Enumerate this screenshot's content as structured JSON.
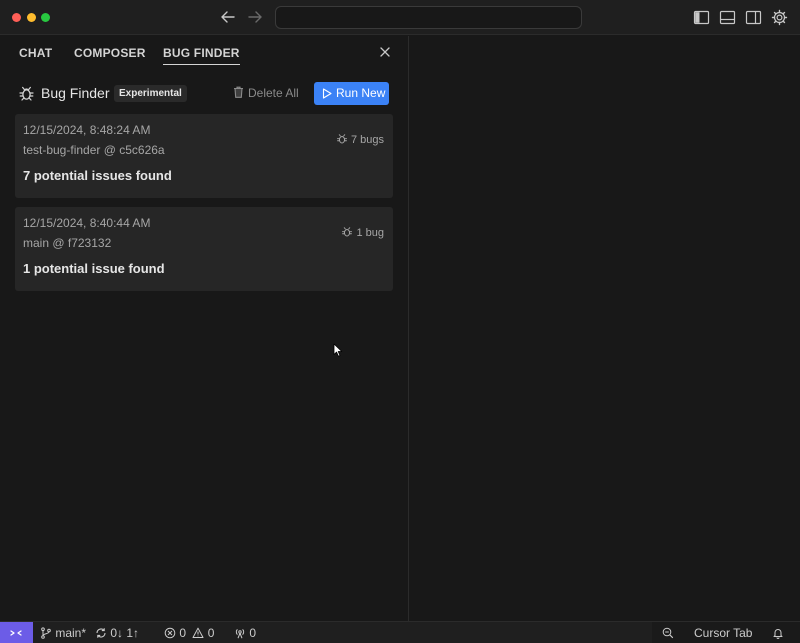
{
  "titlebar": {
    "icons": [
      "back-arrow-icon",
      "forward-arrow-icon",
      "toggle-primary-sidebar-icon",
      "toggle-panel-icon",
      "toggle-secondary-sidebar-icon",
      "gear-icon"
    ]
  },
  "tabs": [
    {
      "label": "CHAT"
    },
    {
      "label": "COMPOSER"
    },
    {
      "label": "BUG FINDER",
      "active": true
    }
  ],
  "bug_finder": {
    "title": "Bug Finder",
    "badge": "Experimental",
    "delete_all_label": "Delete All",
    "run_new_label": "Run New"
  },
  "runs": [
    {
      "timestamp": "12/15/2024, 8:48:24 AM",
      "ref": "test-bug-finder @ c5c626a",
      "bug_count": "7 bugs",
      "summary": "7 potential issues found"
    },
    {
      "timestamp": "12/15/2024, 8:40:44 AM",
      "ref": "main @ f723132",
      "bug_count": "1 bug",
      "summary": "1 potential issue found"
    }
  ],
  "statusbar": {
    "branch": "main*",
    "sync": "0↓ 1↑",
    "errors": "0",
    "warnings": "0",
    "ports": "0",
    "cursor_tab": "Cursor Tab"
  },
  "colors": {
    "accent": "#3b82f6",
    "remote": "#6c5ce7",
    "background": "#181818",
    "card": "#262626"
  }
}
